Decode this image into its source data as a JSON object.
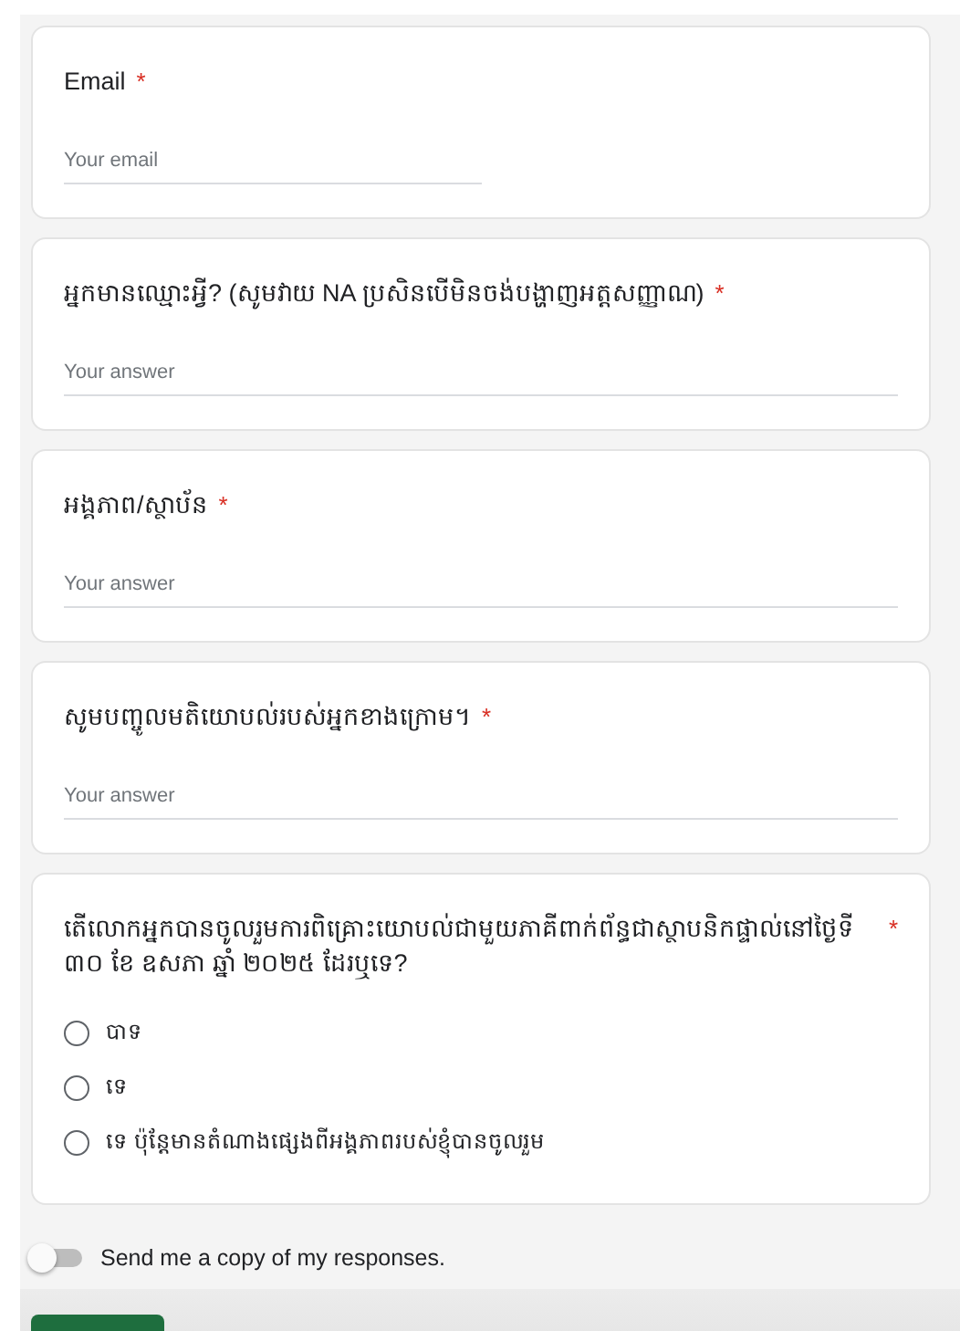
{
  "questions": [
    {
      "kind": "email",
      "title": "Email",
      "required_mark": "*",
      "placeholder": "Your email"
    },
    {
      "kind": "text",
      "title": "អ្នកមានឈ្មោះអ្វី? (សូមវាយ NA ប្រសិនបើមិនចង់បង្ហាញអត្តសញ្ញាណ)",
      "required_mark": "*",
      "placeholder": "Your answer"
    },
    {
      "kind": "text",
      "title": "អង្គភាព/ស្ថាប័ន",
      "required_mark": "*",
      "placeholder": "Your answer"
    },
    {
      "kind": "text",
      "title": "សូមបញ្ចូលមតិយោបល់របស់អ្នកខាងក្រោម។",
      "required_mark": "*",
      "placeholder": "Your answer"
    },
    {
      "kind": "radio",
      "title": "តើលោកអ្នកបានចូលរួមការពិគ្រោះយោបល់ជាមួយភាគីពាក់ព័ន្ធជាស្ថាបនិកផ្ទាល់នៅថ្ងៃទី ៣០ ខែ ឧសភា ឆ្នាំ ២០២៥ ដែរឬទេ?",
      "required_mark": "*",
      "options": [
        {
          "label": "បាទ",
          "selected": false
        },
        {
          "label": "ទេ",
          "selected": false
        },
        {
          "label": "ទេ ប៉ុន្តែមានតំណាងផ្សេងពីអង្គភាពរបស់ខ្ញុំបានចូលរួម",
          "selected": false
        }
      ]
    }
  ],
  "copy_toggle": {
    "label": "Send me a copy of my responses.",
    "on": false
  }
}
